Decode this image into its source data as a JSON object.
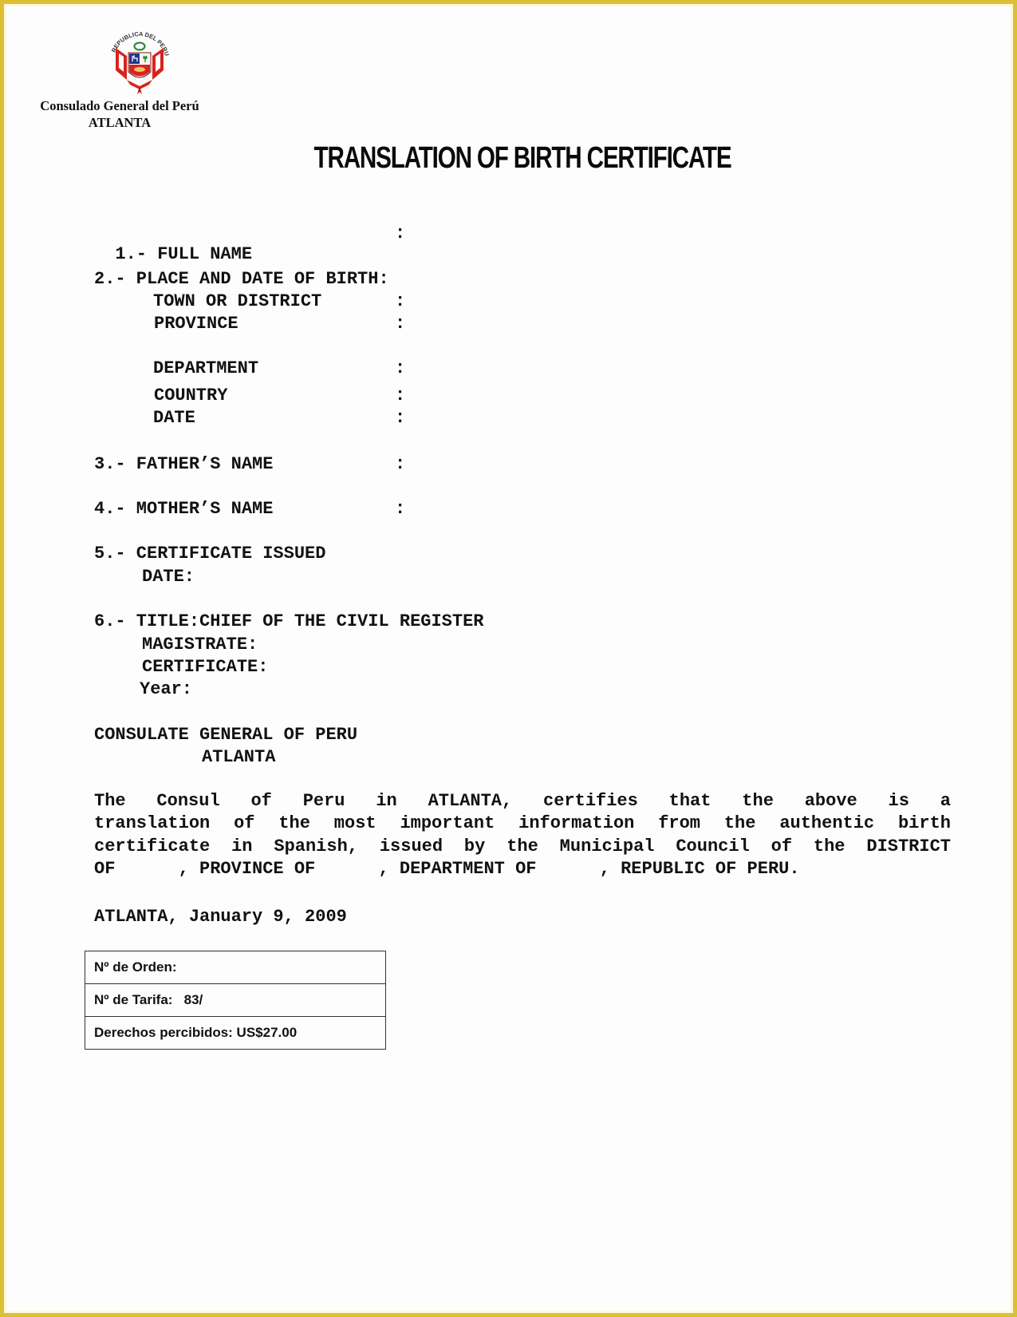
{
  "header": {
    "seal_text": "REPUBLICA DEL PERU",
    "consulate_line1": "Consulado General del Perú",
    "consulate_line2": "ATLANTA"
  },
  "title": "TRANSLATION OF BIRTH CERTIFICATE",
  "fields": {
    "full_name": "1.- FULL NAME",
    "place_date_birth": "2.- PLACE AND DATE OF BIRTH:",
    "town_or_district": "TOWN OR DISTRICT",
    "province": "PROVINCE",
    "department": "DEPARTMENT",
    "country": "COUNTRY",
    "date": "DATE",
    "fathers_name": "3.- FATHER’S NAME",
    "mothers_name": "4.- MOTHER’S NAME",
    "certificate_issued": "5.- CERTIFICATE ISSUED",
    "certificate_issued_date": "DATE:",
    "title_line": "6.- TITLE:CHIEF OF THE CIVIL REGISTER",
    "magistrate": "MAGISTRATE:",
    "certificate": "CERTIFICATE:",
    "year": "Year:",
    "colon": ":"
  },
  "signature_block": {
    "line1": "CONSULATE GENERAL OF PERU",
    "line2": "ATLANTA"
  },
  "certification_paragraph": {
    "line1": "The Consul of Peru in ATLANTA, certifies that the above is a",
    "line2": "translation of the most important information from the authentic birth",
    "line3": "certificate in Spanish, issued by the Municipal Council of the DISTRICT",
    "line4": "OF      , PROVINCE OF      , DEPARTMENT OF      , REPUBLIC OF PERU."
  },
  "place_date": "ATLANTA, January 9, 2009",
  "fee_table": {
    "order_number": "Nº de Orden:",
    "tariff_number": "Nº de Tarifa:   83/",
    "fees_collected": "Derechos percibidos: US$27.00"
  },
  "colors": {
    "page_border": "#dcbf35",
    "seal_red": "#d8231f",
    "seal_green": "#2e8b3a",
    "seal_blue": "#1d3a8a"
  }
}
